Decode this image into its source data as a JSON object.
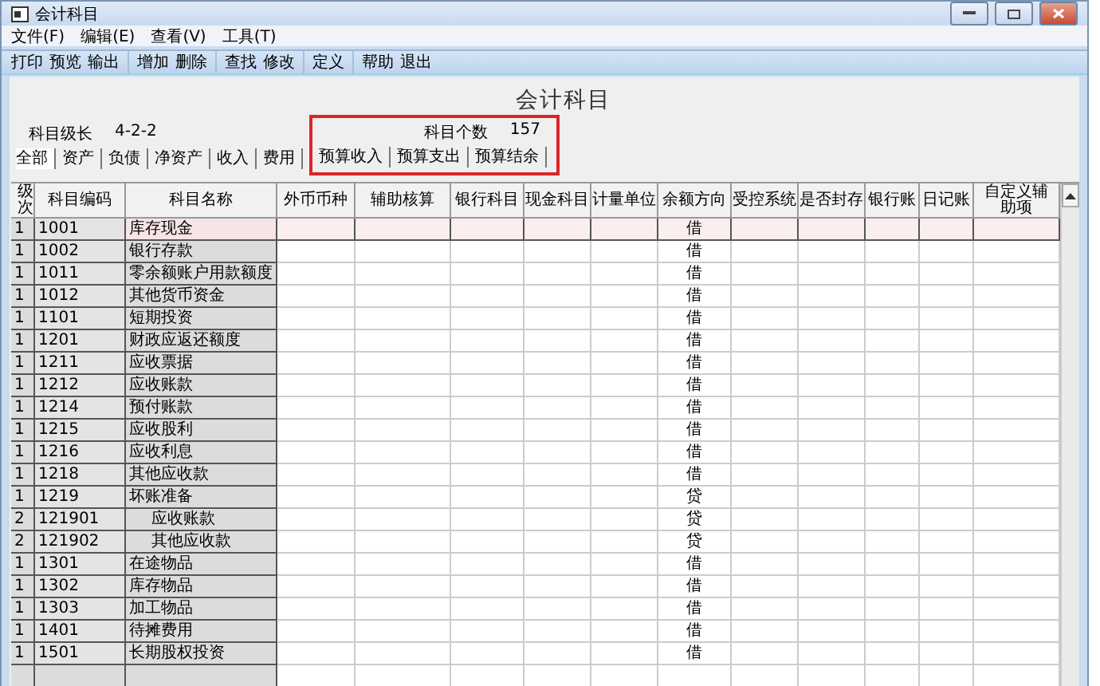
{
  "window": {
    "title": "会计科目"
  },
  "menu": [
    "文件(F)",
    "编辑(E)",
    "查看(V)",
    "工具(T)"
  ],
  "toolbar": [
    [
      "打印",
      "预览",
      "输出"
    ],
    [
      "增加",
      "删除"
    ],
    [
      "查找",
      "修改"
    ],
    [
      "定义"
    ],
    [
      "帮助",
      "退出"
    ]
  ],
  "heading": "会计科目",
  "level_format": {
    "label": "科目级长",
    "value": "4-2-2"
  },
  "count": {
    "label": "科目个数",
    "value": "157"
  },
  "tabs": [
    {
      "label": "全部",
      "selected": true
    },
    {
      "label": "资产",
      "selected": false
    },
    {
      "label": "负债",
      "selected": false
    },
    {
      "label": "净资产",
      "selected": false
    },
    {
      "label": "收入",
      "selected": false
    },
    {
      "label": "费用",
      "selected": false
    },
    {
      "label": "预算收入",
      "selected": false
    },
    {
      "label": "预算支出",
      "selected": false
    },
    {
      "label": "预算结余",
      "selected": false
    }
  ],
  "table": {
    "columns": [
      "级次",
      "科目编码",
      "科目名称",
      "外币币种",
      "辅助核算",
      "银行科目",
      "现金科目",
      "计量单位",
      "余额方向",
      "受控系统",
      "是否封存",
      "银行账",
      "日记账",
      "自定义辅助项"
    ],
    "rows": [
      {
        "level": "1",
        "code": "1001",
        "name": "库存现金",
        "direction": "借",
        "selected": true
      },
      {
        "level": "1",
        "code": "1002",
        "name": "银行存款",
        "direction": "借",
        "selected": false
      },
      {
        "level": "1",
        "code": "1011",
        "name": "零余额账户用款额度",
        "direction": "借",
        "selected": false
      },
      {
        "level": "1",
        "code": "1012",
        "name": "其他货币资金",
        "direction": "借",
        "selected": false
      },
      {
        "level": "1",
        "code": "1101",
        "name": "短期投资",
        "direction": "借",
        "selected": false
      },
      {
        "level": "1",
        "code": "1201",
        "name": "财政应返还额度",
        "direction": "借",
        "selected": false
      },
      {
        "level": "1",
        "code": "1211",
        "name": "应收票据",
        "direction": "借",
        "selected": false
      },
      {
        "level": "1",
        "code": "1212",
        "name": "应收账款",
        "direction": "借",
        "selected": false
      },
      {
        "level": "1",
        "code": "1214",
        "name": "预付账款",
        "direction": "借",
        "selected": false
      },
      {
        "level": "1",
        "code": "1215",
        "name": "应收股利",
        "direction": "借",
        "selected": false
      },
      {
        "level": "1",
        "code": "1216",
        "name": "应收利息",
        "direction": "借",
        "selected": false
      },
      {
        "level": "1",
        "code": "1218",
        "name": "其他应收款",
        "direction": "借",
        "selected": false
      },
      {
        "level": "1",
        "code": "1219",
        "name": "坏账准备",
        "direction": "贷",
        "selected": false,
        "children": [
          {
            "level": "2",
            "code": "121901",
            "name": "应收账款",
            "direction": "贷",
            "selected": false
          },
          {
            "level": "2",
            "code": "121902",
            "name": "其他应收款",
            "direction": "贷",
            "selected": false
          }
        ]
      },
      {
        "level": "1",
        "code": "1301",
        "name": "在途物品",
        "direction": "借",
        "selected": false
      },
      {
        "level": "1",
        "code": "1302",
        "name": "库存物品",
        "direction": "借",
        "selected": false
      },
      {
        "level": "1",
        "code": "1303",
        "name": "加工物品",
        "direction": "借",
        "selected": false
      },
      {
        "level": "1",
        "code": "1401",
        "name": "待摊费用",
        "direction": "借",
        "selected": false
      },
      {
        "level": "1",
        "code": "1501",
        "name": "长期股权投资",
        "direction": "借",
        "selected": false
      }
    ]
  }
}
